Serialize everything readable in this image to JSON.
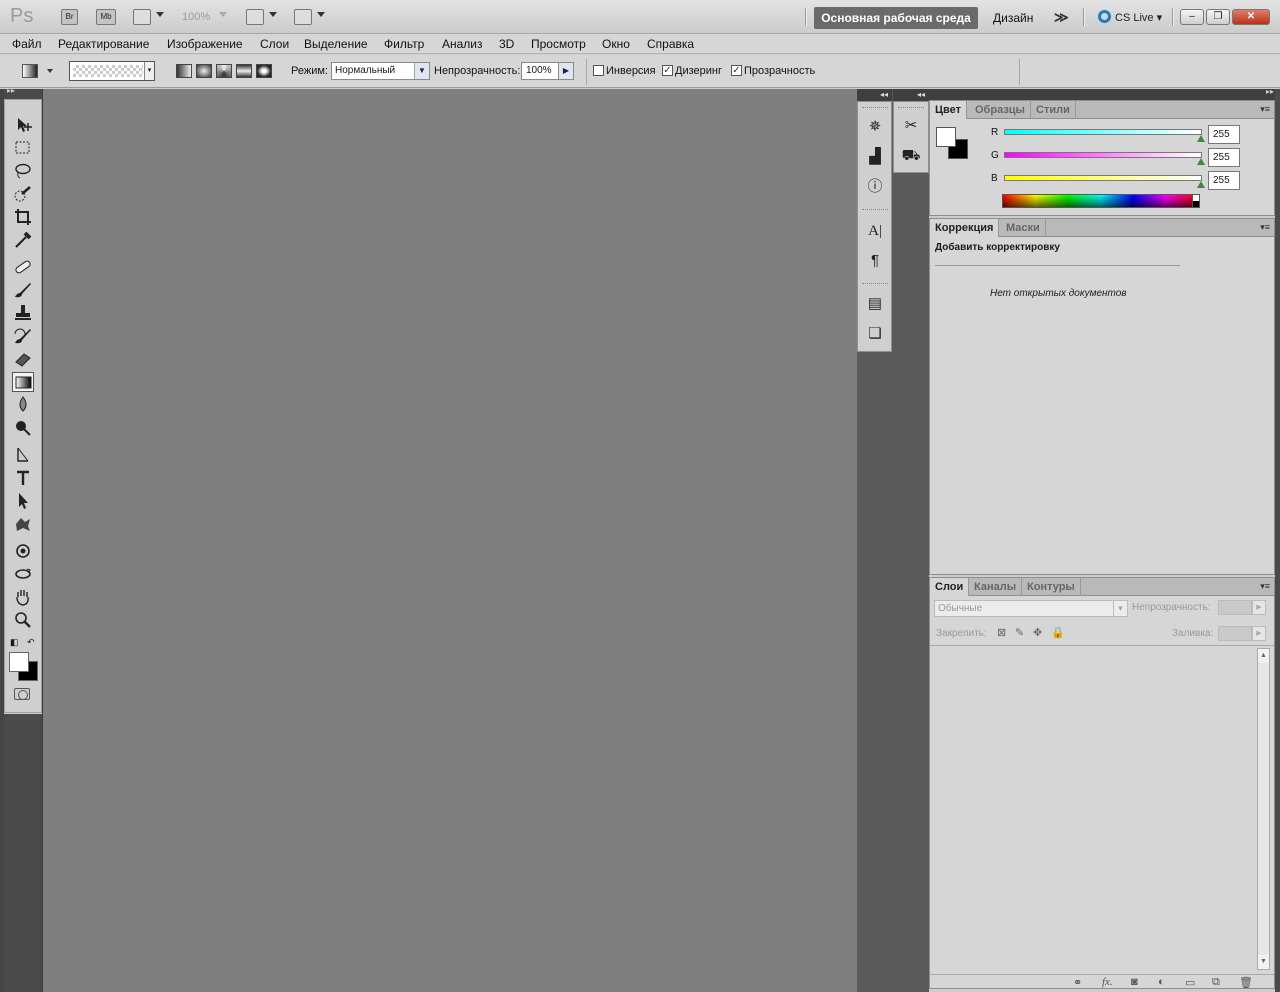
{
  "app": {
    "logo": "Ps",
    "bridge_label": "Br",
    "minibridge_label": "Mb",
    "zoom": "100%",
    "workspace_active": "Основная рабочая среда",
    "workspace_design": "Дизайн",
    "more": "≫",
    "cs_live": "CS Live"
  },
  "menu": [
    "Файл",
    "Редактирование",
    "Изображение",
    "Слои",
    "Выделение",
    "Фильтр",
    "Анализ",
    "3D",
    "Просмотр",
    "Окно",
    "Справка"
  ],
  "options": {
    "mode_label": "Режим:",
    "mode_value": "Нормальный",
    "opacity_label": "Непрозрачность:",
    "opacity_value": "100%",
    "inverse_label": "Инверсия",
    "inverse_checked": false,
    "dither_label": "Дизеринг",
    "dither_checked": true,
    "transparency_label": "Прозрачность",
    "transparency_checked": true
  },
  "color_panel": {
    "tabs": [
      "Цвет",
      "Образцы",
      "Стили"
    ],
    "active_tab": "Цвет",
    "r_label": "R",
    "r_value": "255",
    "g_label": "G",
    "g_value": "255",
    "b_label": "B",
    "b_value": "255",
    "r_color": "#00ffff",
    "g_color": "#ff00ff",
    "b_color": "#ffff00"
  },
  "adjust_panel": {
    "tabs": [
      "Коррекция",
      "Маски"
    ],
    "title": "Добавить корректировку",
    "empty": "Нет открытых документов"
  },
  "layers_panel": {
    "tabs": [
      "Слои",
      "Каналы",
      "Контуры"
    ],
    "blend_mode": "Обычные",
    "opacity_label": "Непрозрачность:",
    "lock_label": "Закрепить:",
    "fill_label": "Заливка:"
  }
}
